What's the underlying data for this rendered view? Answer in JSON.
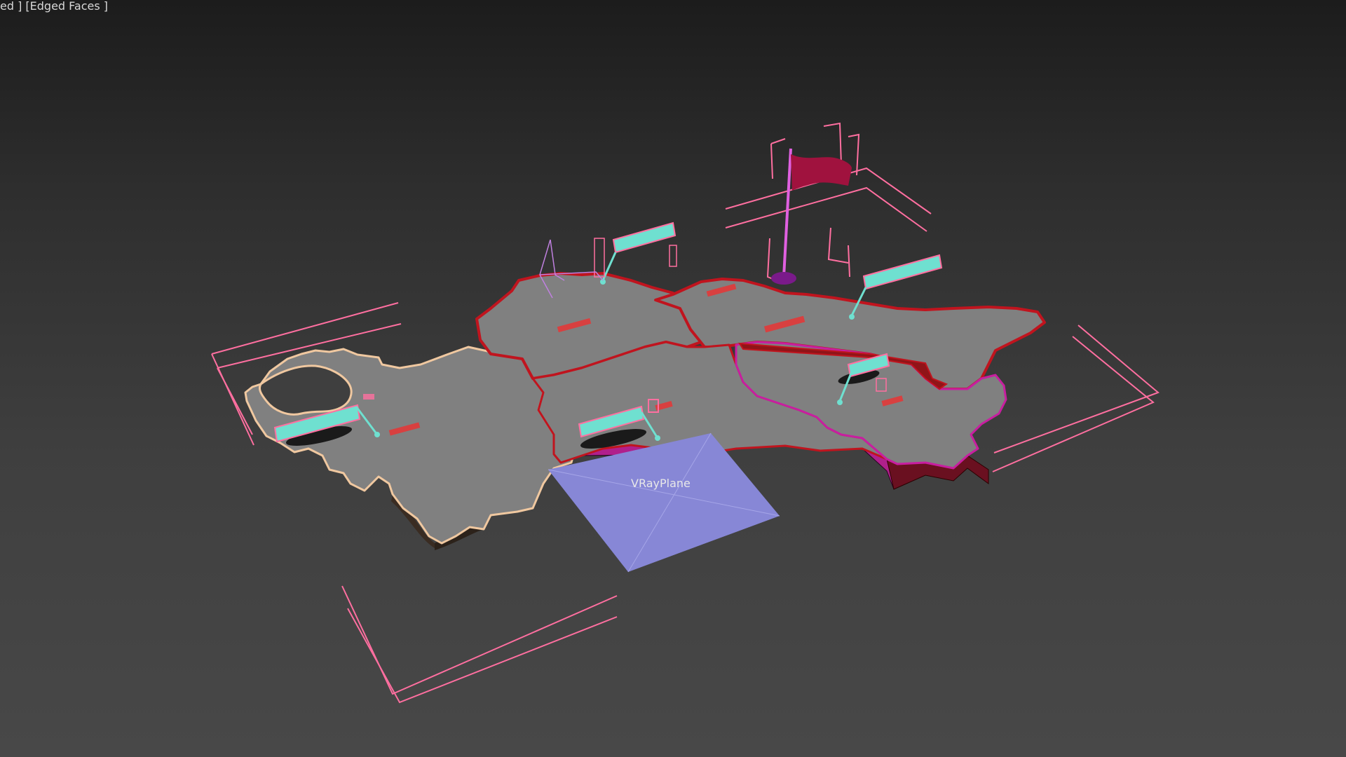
{
  "viewport": {
    "label": "ed ] [Edged Faces ]",
    "background_top": "#1c1c1c",
    "background_bottom": "#484848"
  },
  "objects": {
    "vray_plane": {
      "label": "VRayPlane",
      "color": "#8787d6"
    },
    "flag": {
      "color": "#a0123e"
    }
  },
  "colors": {
    "map_surface": "#808080",
    "selection_pink": "#ff6fa0",
    "region_outline_red": "#c0141e",
    "region_outline_magenta": "#c81ea0",
    "region_outline_peach": "#f0c8a0",
    "label_cyan": "#6fe0d0"
  }
}
